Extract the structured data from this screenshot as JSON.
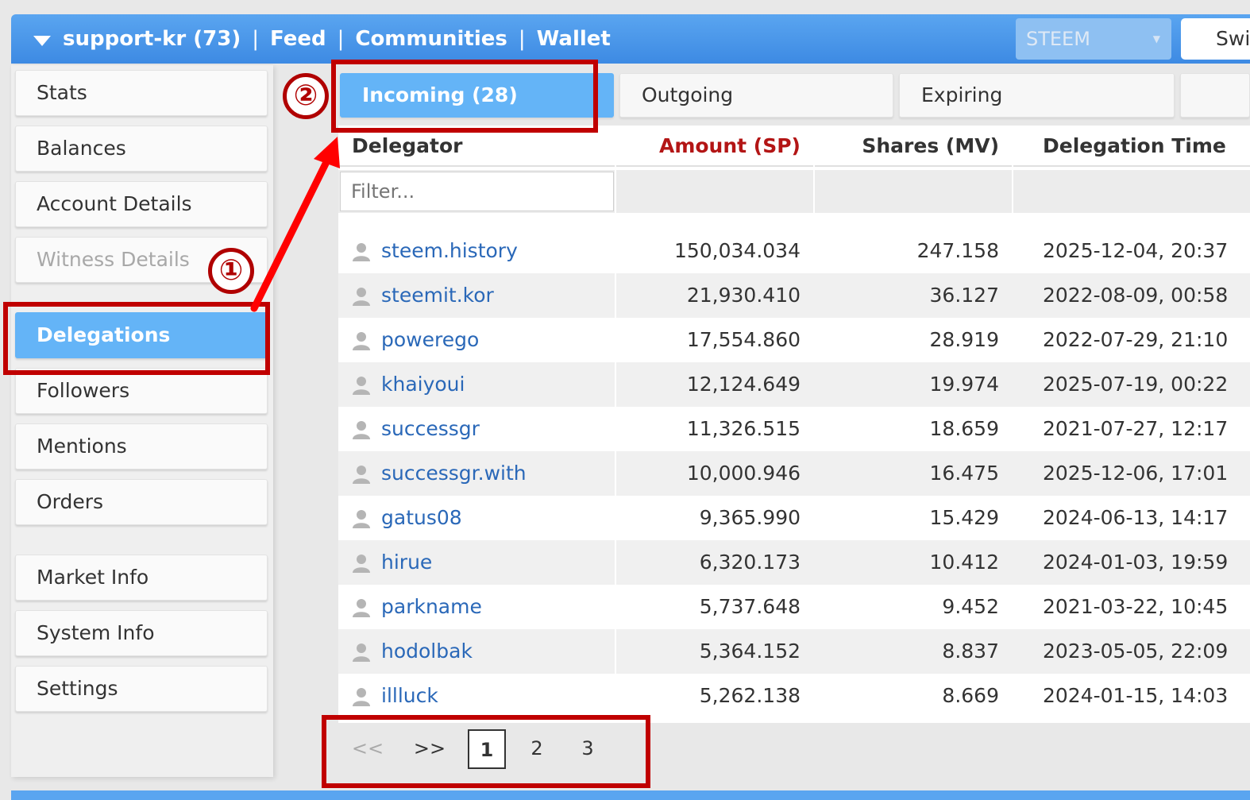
{
  "topbar": {
    "account": "support-kr (73)",
    "nav": [
      "Feed",
      "Communities",
      "Wallet"
    ],
    "separator": "|",
    "selector_value": "STEEM",
    "switch_label": "Swi"
  },
  "sidebar": {
    "items": [
      {
        "label": "Stats"
      },
      {
        "label": "Balances"
      },
      {
        "label": "Account Details"
      },
      {
        "label": "Witness Details"
      },
      {
        "label": "Delegations"
      },
      {
        "label": "Followers"
      },
      {
        "label": "Mentions"
      },
      {
        "label": "Orders"
      },
      {
        "label": "Market Info"
      },
      {
        "label": "System Info"
      },
      {
        "label": "Settings"
      }
    ]
  },
  "tabs": [
    {
      "label": "Incoming (28)"
    },
    {
      "label": "Outgoing"
    },
    {
      "label": "Expiring"
    }
  ],
  "table": {
    "headers": [
      "Delegator",
      "Amount (SP)",
      "Shares (MV)",
      "Delegation Time"
    ],
    "filter_placeholder": "Filter...",
    "rows": [
      {
        "name": "steem.history",
        "amount": "150,034.034",
        "shares": "247.158",
        "time": "2025-12-04, 20:37"
      },
      {
        "name": "steemit.kor",
        "amount": "21,930.410",
        "shares": "36.127",
        "time": "2022-08-09, 00:58"
      },
      {
        "name": "powerego",
        "amount": "17,554.860",
        "shares": "28.919",
        "time": "2022-07-29, 21:10"
      },
      {
        "name": "khaiyoui",
        "amount": "12,124.649",
        "shares": "19.974",
        "time": "2025-07-19, 00:22"
      },
      {
        "name": "successgr",
        "amount": "11,326.515",
        "shares": "18.659",
        "time": "2021-07-27, 12:17"
      },
      {
        "name": "successgr.with",
        "amount": "10,000.946",
        "shares": "16.475",
        "time": "2025-12-06, 17:01"
      },
      {
        "name": "gatus08",
        "amount": "9,365.990",
        "shares": "15.429",
        "time": "2024-06-13, 14:17"
      },
      {
        "name": "hirue",
        "amount": "6,320.173",
        "shares": "10.412",
        "time": "2024-01-03, 19:59"
      },
      {
        "name": "parkname",
        "amount": "5,737.648",
        "shares": "9.452",
        "time": "2021-03-22, 10:45"
      },
      {
        "name": "hodolbak",
        "amount": "5,364.152",
        "shares": "8.837",
        "time": "2023-05-05, 22:09"
      },
      {
        "name": "illluck",
        "amount": "5,262.138",
        "shares": "8.669",
        "time": "2024-01-15, 14:03"
      }
    ]
  },
  "pagination": {
    "prev": "<<",
    "next": ">>",
    "pages": [
      "1",
      "2",
      "3"
    ]
  },
  "annotations": {
    "step1": "①",
    "step2": "②"
  },
  "colors": {
    "accent": "#64b4f7",
    "annotation": "#c00000",
    "link": "#2a68b8"
  }
}
